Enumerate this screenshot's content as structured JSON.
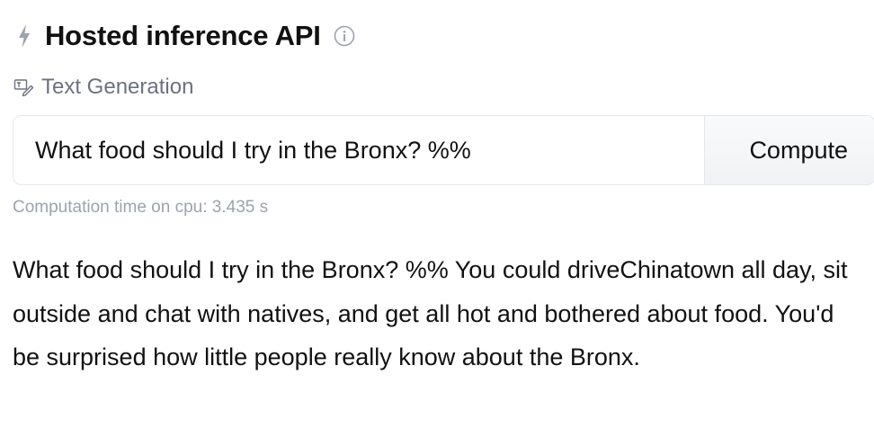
{
  "widget": {
    "title": "Hosted inference API",
    "bolt_icon": "lightning-bolt-icon",
    "info_icon": "info-circle-icon",
    "task": {
      "icon": "text-generation-icon",
      "label": "Text Generation"
    },
    "input": {
      "value": "What food should I try in the Bronx? %%"
    },
    "compute_label": "Compute",
    "computation_time": "Computation time on cpu: 3.435 s",
    "output_text": "What food should I try in the Bronx? %% You could driveChinatown all day, sit outside and chat with natives, and get all hot and bothered about food. You'd be surprised how little people really know about the Bronx."
  }
}
